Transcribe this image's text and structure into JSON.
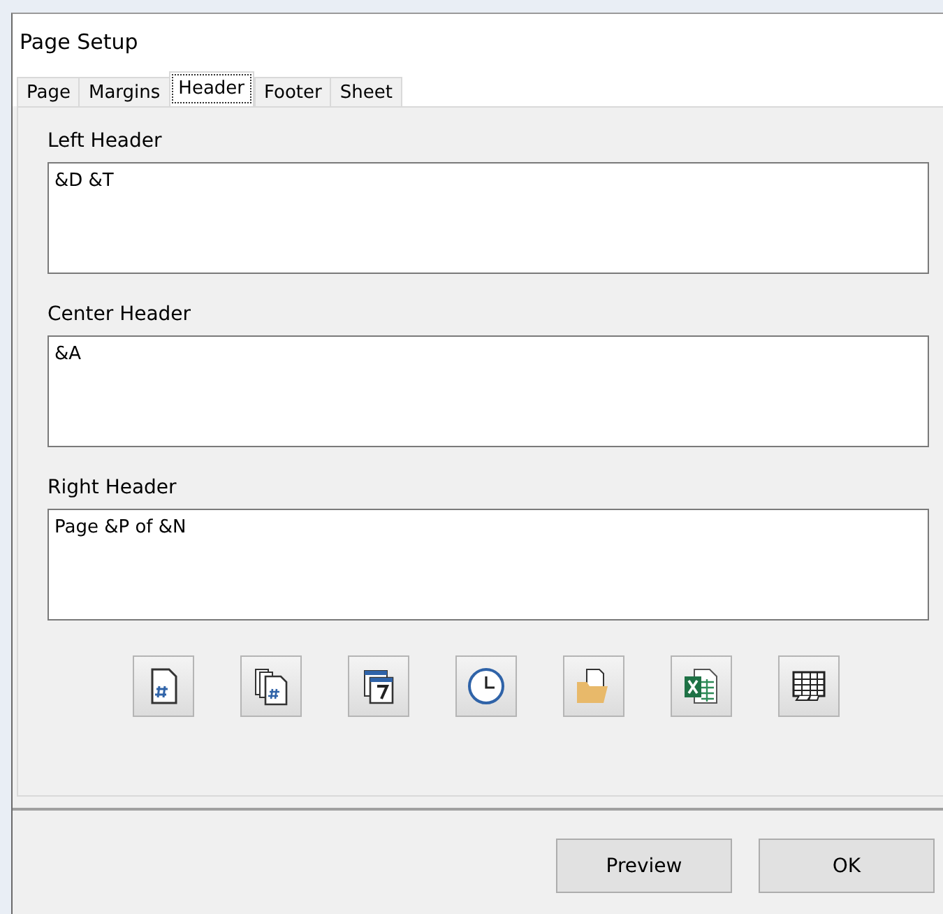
{
  "window": {
    "title": "Page Setup"
  },
  "tabs": [
    {
      "label": "Page",
      "selected": false
    },
    {
      "label": "Margins",
      "selected": false
    },
    {
      "label": "Header",
      "selected": true
    },
    {
      "label": "Footer",
      "selected": false
    },
    {
      "label": "Sheet",
      "selected": false
    }
  ],
  "sections": [
    {
      "label": "Left Header",
      "value": "&D &T"
    },
    {
      "label": "Center Header",
      "value": "&A"
    },
    {
      "label": "Right Header",
      "value": "Page &P of &N"
    }
  ],
  "buttons": [
    {
      "label": "Preview"
    },
    {
      "label": "OK"
    }
  ]
}
